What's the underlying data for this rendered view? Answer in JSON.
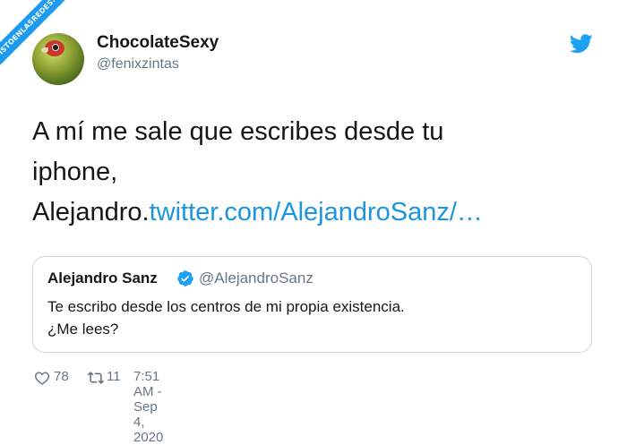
{
  "watermark": {
    "text": "VISTOENLASREDES.com"
  },
  "author": {
    "display_name": "ChocolateSexy",
    "handle": "@fenixzintas",
    "avatar": "parrot-avatar"
  },
  "icons": {
    "brand": "twitter-bird-icon",
    "verified": "verified-badge-icon",
    "like": "heart-icon",
    "retweet": "retweet-icon"
  },
  "colors": {
    "twitter_blue": "#1da1f2",
    "link": "#1b95e0",
    "secondary_text": "#657786",
    "border": "#ccd6dd"
  },
  "tweet": {
    "text_line1": "A mí me sale que escribes desde tu",
    "text_line2": "iphone,",
    "text_line3_plain": "Alejandro.",
    "text_link": "twitter.com/AlejandroSanz/…"
  },
  "quoted_tweet": {
    "display_name": "Alejandro Sanz",
    "handle": "@AlejandroSanz",
    "text_line1": "Te escribo desde los centros de mi propia existencia.",
    "text_line2": "¿Me lees?"
  },
  "footer": {
    "likes": "78",
    "retweets": "11",
    "timestamp": "7:51 AM - Sep 4, 2020"
  }
}
